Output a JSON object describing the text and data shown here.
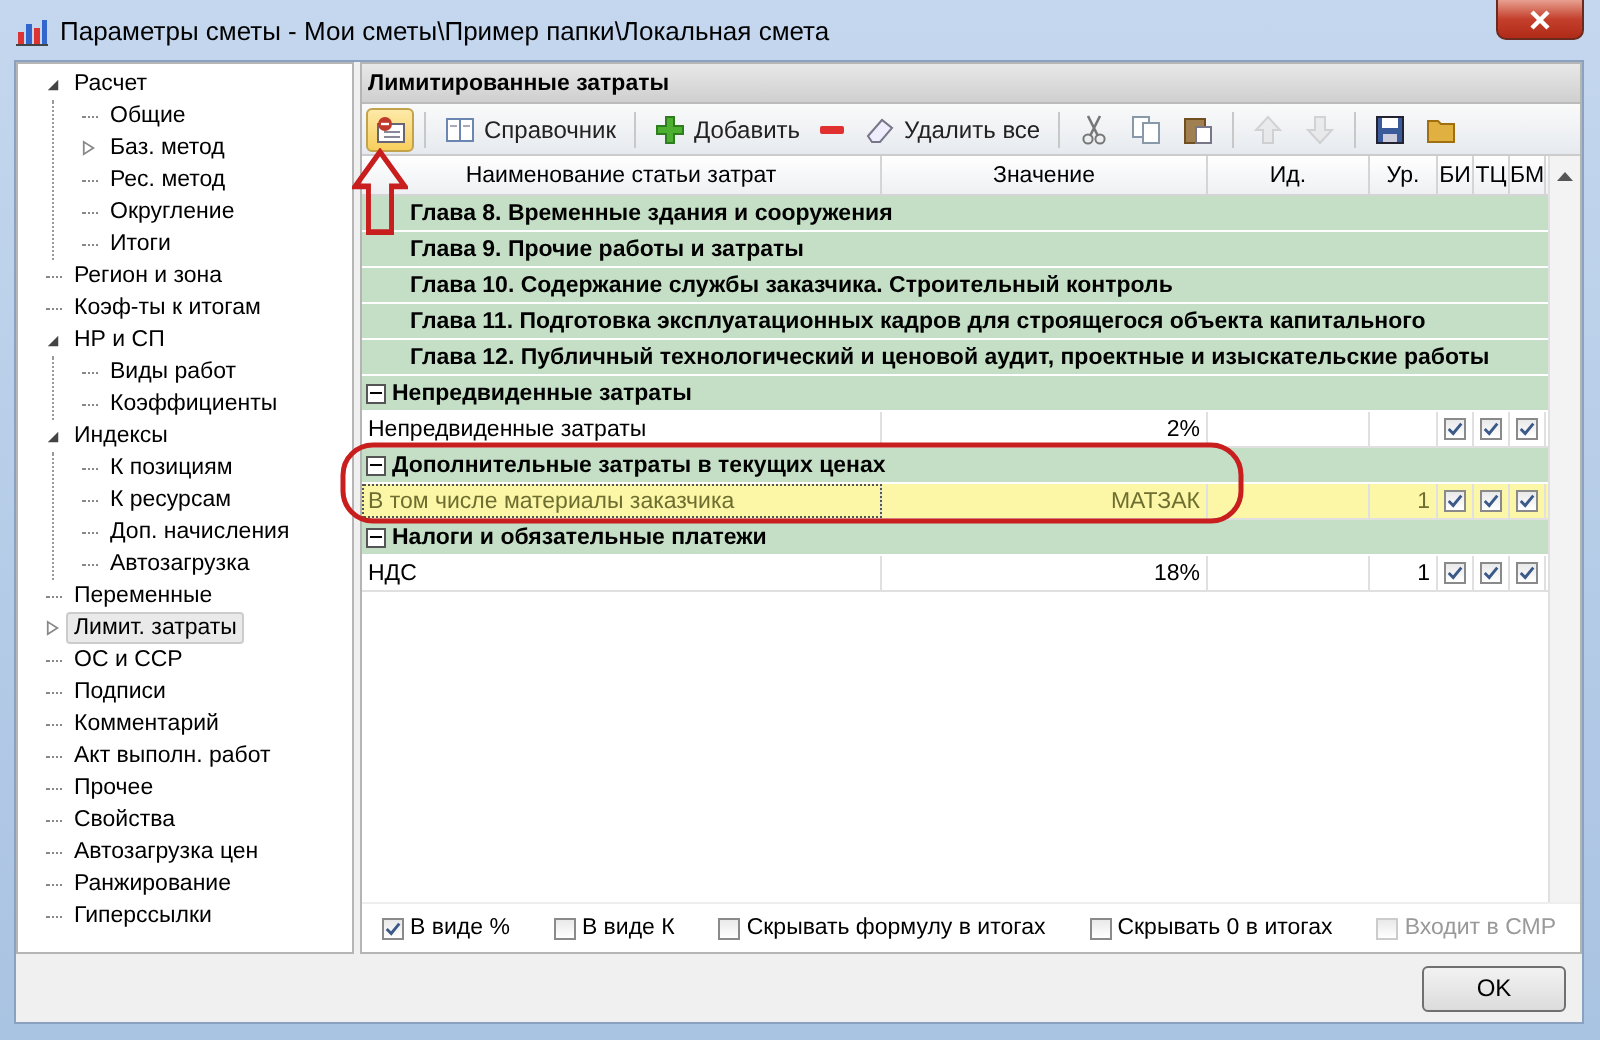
{
  "window": {
    "title": "Параметры сметы - Мои сметы\\Пример папки\\Локальная смета"
  },
  "tree": {
    "items": [
      {
        "label": "Расчет",
        "expanded": true,
        "selected": false,
        "children": [
          {
            "label": "Общие",
            "selected": false
          },
          {
            "label": "Баз. метод",
            "expanded": false,
            "selected": false
          },
          {
            "label": "Рес. метод",
            "selected": false
          },
          {
            "label": "Округление",
            "selected": false
          },
          {
            "label": "Итоги",
            "selected": false
          }
        ]
      },
      {
        "label": "Регион и зона",
        "selected": false
      },
      {
        "label": "Коэф-ты к итогам",
        "selected": false
      },
      {
        "label": "НР и СП",
        "expanded": true,
        "selected": false,
        "children": [
          {
            "label": "Виды работ",
            "selected": false
          },
          {
            "label": "Коэффициенты",
            "selected": false
          }
        ]
      },
      {
        "label": "Индексы",
        "expanded": true,
        "selected": false,
        "children": [
          {
            "label": "К позициям",
            "selected": false
          },
          {
            "label": "К ресурсам",
            "selected": false
          },
          {
            "label": "Доп. начисления",
            "selected": false
          },
          {
            "label": "Автозагрузка",
            "selected": false
          }
        ]
      },
      {
        "label": "Переменные",
        "selected": false
      },
      {
        "label": "Лимит. затраты",
        "expanded": false,
        "selected": true
      },
      {
        "label": "ОС и ССР",
        "selected": false
      },
      {
        "label": "Подписи",
        "selected": false
      },
      {
        "label": "Комментарий",
        "selected": false
      },
      {
        "label": "Акт выполн. работ",
        "selected": false
      },
      {
        "label": "Прочее",
        "selected": false
      },
      {
        "label": "Свойства",
        "selected": false
      },
      {
        "label": "Автозагрузка цен",
        "selected": false
      },
      {
        "label": "Ранжирование",
        "selected": false
      },
      {
        "label": "Гиперссылки",
        "selected": false
      }
    ]
  },
  "panel": {
    "title": "Лимитированные затраты"
  },
  "toolbar": [
    {
      "kind": "card",
      "pressed": true,
      "disabled": false
    },
    {
      "kind": "book",
      "label": "Справочник",
      "pressed": false,
      "disabled": false
    },
    {
      "kind": "plus",
      "label": "Добавить",
      "pressed": false,
      "disabled": false
    },
    {
      "kind": "minus",
      "pressed": false,
      "disabled": false
    },
    {
      "kind": "eraser",
      "label": "Удалить все",
      "pressed": false,
      "disabled": false
    },
    {
      "kind": "cut",
      "pressed": false,
      "disabled": false
    },
    {
      "kind": "copy",
      "pressed": false,
      "disabled": false
    },
    {
      "kind": "paste",
      "pressed": false,
      "disabled": false
    },
    {
      "kind": "up",
      "pressed": false,
      "disabled": true
    },
    {
      "kind": "down",
      "pressed": false,
      "disabled": true
    },
    {
      "kind": "save",
      "pressed": false,
      "disabled": false
    },
    {
      "kind": "folder",
      "pressed": false,
      "disabled": false
    }
  ],
  "table": {
    "columns": [
      "Наименование статьи затрат",
      "Значение",
      "Ид.",
      "Ур.",
      "БИ",
      "ТЦ",
      "БМ"
    ],
    "rows": [
      {
        "kind": "chapter",
        "name": "Глава 8. Временные здания и сооружения",
        "selected": false
      },
      {
        "kind": "chapter",
        "name": "Глава 9. Прочие работы и затраты",
        "selected": false
      },
      {
        "kind": "chapter",
        "name": "Глава 10. Содержание службы заказчика. Строительный контроль",
        "selected": false
      },
      {
        "kind": "chapter",
        "name": "Глава 11. Подготовка эксплуатационных кадров для строящегося объекта капитального",
        "selected": false
      },
      {
        "kind": "chapter",
        "name": "Глава 12. Публичный технологический и ценовой аудит, проектные и изыскательские работы",
        "selected": false
      },
      {
        "kind": "group",
        "name": "Непредвиденные затраты",
        "expanded": true,
        "selected": false
      },
      {
        "kind": "item",
        "name": "Непредвиденные затраты",
        "value": "2%",
        "bi": true,
        "tc": true,
        "bm": true,
        "selected": false
      },
      {
        "kind": "group",
        "name": "Дополнительные затраты в текущих ценах",
        "expanded": true,
        "selected": false
      },
      {
        "kind": "item",
        "name": "В том числе материалы заказчика",
        "value": "МАТЗАК",
        "ur": "1",
        "bi": true,
        "tc": true,
        "bm": true,
        "selected": true
      },
      {
        "kind": "group",
        "name": "Налоги и обязательные платежи",
        "expanded": true,
        "selected": false
      },
      {
        "kind": "item",
        "name": "НДС",
        "value": "18%",
        "ur": "1",
        "bi": true,
        "tc": true,
        "bm": true,
        "selected": false
      }
    ]
  },
  "options": [
    {
      "label": "В виде %",
      "checked": true,
      "disabled": false
    },
    {
      "label": "В виде К",
      "checked": false,
      "disabled": false
    },
    {
      "label": "Скрывать формулу в итогах",
      "checked": false,
      "disabled": false
    },
    {
      "label": "Скрывать 0 в итогах",
      "checked": false,
      "disabled": false
    },
    {
      "label": "Входит в СМР",
      "checked": false,
      "disabled": true
    }
  ],
  "buttons": [
    "OK"
  ]
}
